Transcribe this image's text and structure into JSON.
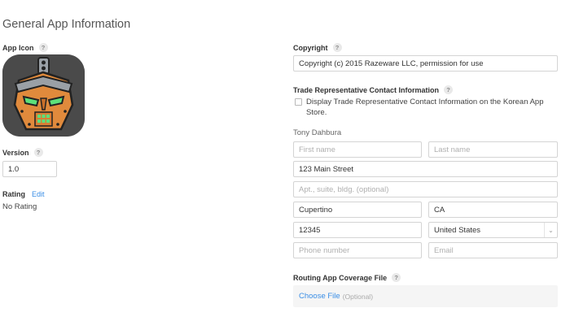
{
  "page": {
    "title": "General App Information"
  },
  "left": {
    "app_icon_label": "App Icon",
    "version_label": "Version",
    "version_value": "1.0",
    "rating_label": "Rating",
    "rating_edit": "Edit",
    "rating_value": "No Rating"
  },
  "right": {
    "copyright_label": "Copyright",
    "copyright_value": "Copyright (c) 2015 Razeware LLC, permission for use",
    "trade_label": "Trade Representative Contact Information",
    "trade_checkbox_text_line1": "Display Trade Representative Contact Information on the Korean App",
    "trade_checkbox_text_line2": "Store.",
    "trade_checked": false,
    "contact_name": "Tony Dahbura",
    "first_name_placeholder": "First name",
    "last_name_placeholder": "Last name",
    "street_value": "123 Main Street",
    "apt_placeholder": "Apt., suite, bldg. (optional)",
    "city_value": "Cupertino",
    "state_value": "CA",
    "zip_value": "12345",
    "country_value": "United States",
    "phone_placeholder": "Phone number",
    "email_placeholder": "Email",
    "routing_label": "Routing App Coverage File",
    "choose_file": "Choose File",
    "choose_file_optional": "(Optional)"
  },
  "help_glyph": "?",
  "icons": {
    "help": "question-mark-icon",
    "select": "chevron-down-icon",
    "app_icon": "robot-app-icon"
  },
  "colors": {
    "link": "#3a8ee6",
    "icon_orange": "#e08a3c",
    "icon_bg": "#4a4a4a",
    "icon_eye_green": "#5de07a"
  }
}
